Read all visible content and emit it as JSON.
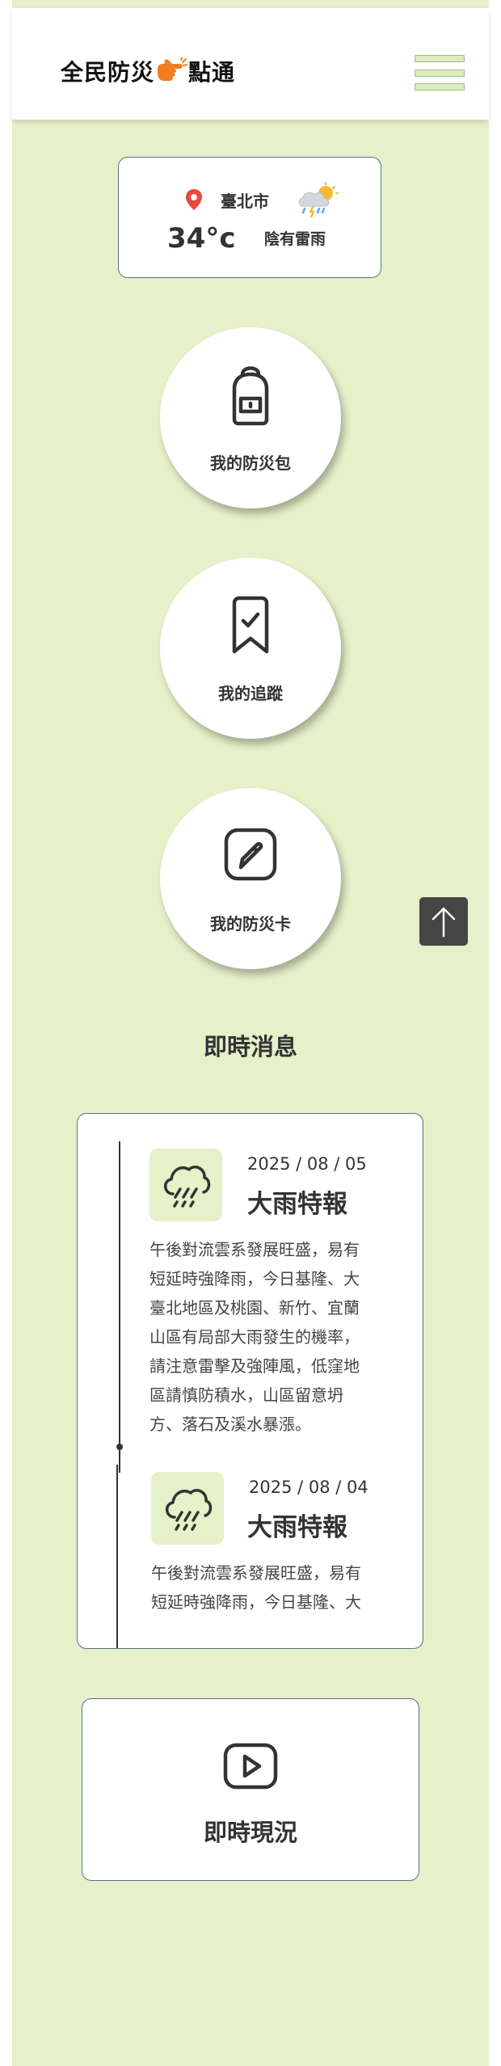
{
  "header": {
    "logo_text_left": "全民防災",
    "logo_text_right": "點通",
    "logo_hand_icon": "pointing-hand-icon",
    "menu_icon": "hamburger-menu-icon"
  },
  "weather": {
    "city": "臺北市",
    "temperature": "34°c",
    "description": "陰有雷雨",
    "icon": "thunderstorm-cloud-icon",
    "pin_color": "#e8473e"
  },
  "quick_actions": [
    {
      "label": "我的防災包",
      "icon": "backpack-icon"
    },
    {
      "label": "我的追蹤",
      "icon": "bookmark-check-icon"
    },
    {
      "label": "我的防災卡",
      "icon": "edit-card-icon"
    }
  ],
  "news": {
    "title": "即時消息",
    "items": [
      {
        "date": "2025 / 08 / 05",
        "title": "大雨特報",
        "icon": "heavy-rain-icon",
        "body": "午後對流雲系發展旺盛，易有短延時強降雨，今日基隆、大臺北地區及桃園、新竹、宜蘭山區有局部大雨發生的機率，請注意雷擊及強陣風，低窪地區請慎防積水，山區留意坍方、落石及溪水暴漲。"
      },
      {
        "date": "2025 / 08 / 04",
        "title": "大雨特報",
        "icon": "heavy-rain-icon",
        "body": "午後對流雲系發展旺盛，易有短延時強降雨，今日基隆、大"
      }
    ]
  },
  "live": {
    "label": "即時現況",
    "icon": "play-button-icon"
  },
  "back_to_top": {
    "icon": "arrow-up-icon"
  },
  "colors": {
    "background": "#e6f0c9",
    "card_border": "#5b6f8b",
    "accent_orange": "#f07d23"
  }
}
